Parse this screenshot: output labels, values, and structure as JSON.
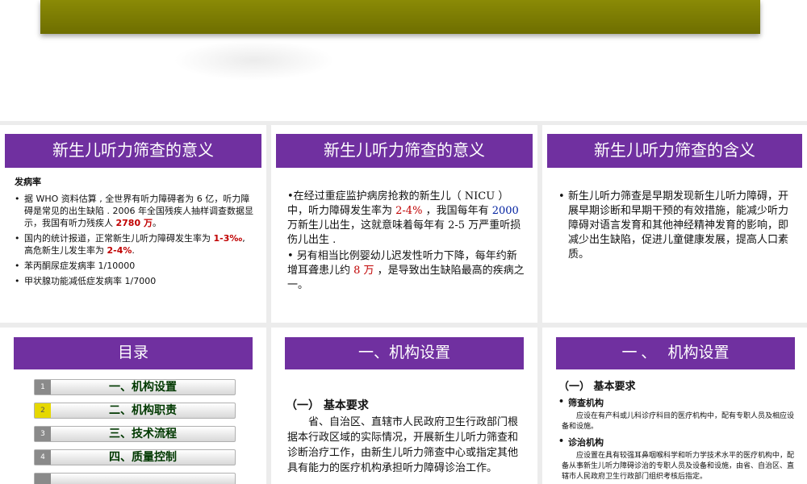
{
  "panel1": {
    "title": "新生儿听力筛查的意义",
    "heading": "发病率",
    "b1": "据 WHO 资料估算 , 全世界有听力障碍者为 6 亿，听力障碍是常见的出生缺陷 . 2006 年全国残疾人抽样调查数据显示，我国有听力残疾人 ",
    "b1_red": "2780 万",
    "b1_end": "。",
    "b2": "国内的统计报道，正常新生儿听力障碍发生率为 ",
    "b2_red1": "1-3‰",
    "b2_mid": ", 高危新生儿发生率为 ",
    "b2_red2": "2-4%",
    "b2_end": ".",
    "b3": "苯丙酮尿症发病率 1/10000",
    "b4": "甲状腺功能减低症发病率 1/7000"
  },
  "panel2": {
    "title": "新生儿听力筛查的意义",
    "p1_a": "•在经过重症监护病房抢救的新生儿（ NICU ）中，听力障碍发生率为 ",
    "p1_red": "2-4%",
    "p1_b": " ，我国每年有 ",
    "p1_blue": "2000",
    "p1_c": " 万新生儿出生，这就意味着每年有 2-5 万严重听损伤儿出生 .",
    "p2_a": "•      另有相当比例婴幼儿迟发性听力下降，每年约新增耳聋患儿约 ",
    "p2_red": "8 万",
    "p2_b": " ，是导致出生缺陷最高的疾病之一。"
  },
  "panel3": {
    "title": "新生儿听力筛查的含义",
    "bullet": "•",
    "text": "新生儿听力筛查是早期发现新生儿听力障碍，开展早期诊断和早期干预的有效措施，能减少听力障碍对语言发育和其他神经精神发育的影响，即减少出生缺陷，促进儿童健康发展，提高人口素质。"
  },
  "toc": {
    "title": "目录",
    "items": [
      {
        "num": "1",
        "label": "一、机构设置"
      },
      {
        "num": "2",
        "label": "二、机构职责"
      },
      {
        "num": "3",
        "label": "三、技术流程"
      },
      {
        "num": "4",
        "label": "四、质量控制"
      }
    ]
  },
  "panel5": {
    "title": "一、机构设置",
    "subtitle": "（一） 基本要求",
    "text": "省、自治区、直辖市人民政府卫生行政部门根据本行政区域的实际情况，开展新生儿听力筛查和诊断治疗工作，由新生儿听力筛查中心或指定其他具有能力的医疗机构承担听力障碍诊治工作。"
  },
  "panel6": {
    "title": "一 、   机构设置",
    "subtitle": "（一） 基本要求",
    "item1_label": "筛查机构",
    "item1_text": "应设在有产科或儿科诊疗科目的医疗机构中，配有专职人员及相应设备和设施。",
    "item2_label": "诊治机构",
    "item2_text": "应设置在具有较强耳鼻咽喉科学和听力学技术水平的医疗机构中，配备从事新生儿听力障碍诊治的专职人员及设备和设施，由省、自治区、直辖市人民政府卫生行政部门组织考核后指定。"
  },
  "colors": {
    "accent_purple": "#7030a0",
    "olive_bar": "#7a7a00",
    "highlight_red": "#c00000"
  }
}
